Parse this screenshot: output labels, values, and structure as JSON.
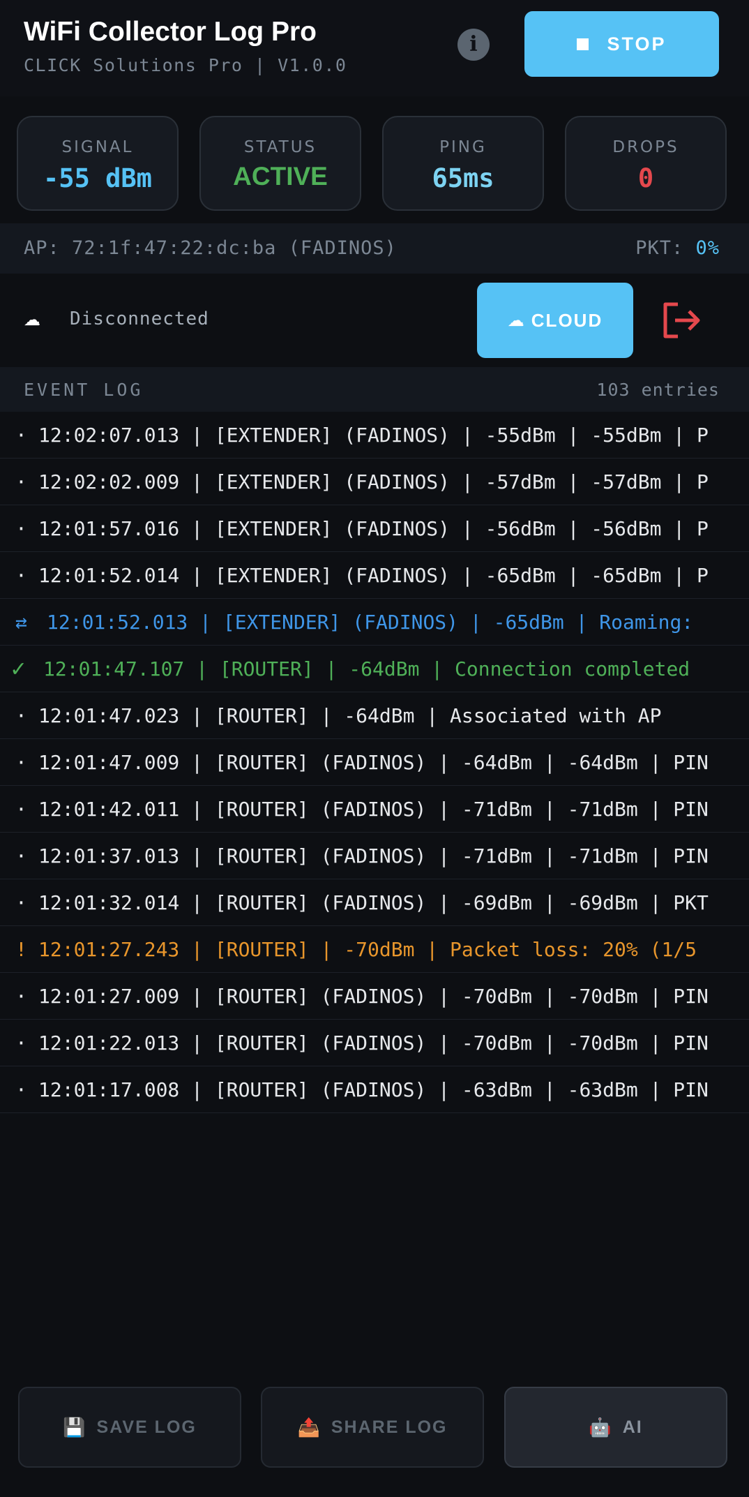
{
  "header": {
    "title": "WiFi Collector Log Pro",
    "subtitle": "CLICK Solutions Pro | V1.0.0",
    "info_icon": "info-icon",
    "stop_label": "STOP"
  },
  "stats": [
    {
      "label": "SIGNAL",
      "value": "-55 dBm",
      "color": "#56c2f5"
    },
    {
      "label": "STATUS",
      "value": "ACTIVE",
      "color": "#4fb058"
    },
    {
      "label": "PING",
      "value": "65ms",
      "color": "#7dd3f2"
    },
    {
      "label": "DROPS",
      "value": "0",
      "color": "#e5484d"
    }
  ],
  "ap": {
    "text": "AP: 72:1f:47:22:dc:ba (FADINOS)",
    "pkt_label": "PKT:",
    "pkt_value": "0%"
  },
  "cloud": {
    "status": "Disconnected",
    "button_label": "CLOUD",
    "icon": "cloud-icon",
    "logout_icon": "logout-icon"
  },
  "event_log": {
    "title": "EVENT LOG",
    "count": "103 entries",
    "entries": [
      {
        "type": "normal",
        "mark": "·",
        "text": "12:02:07.013 | [EXTENDER] (FADINOS) | -55dBm | -55dBm | P"
      },
      {
        "type": "normal",
        "mark": "·",
        "text": "12:02:02.009 | [EXTENDER] (FADINOS) | -57dBm | -57dBm | P"
      },
      {
        "type": "normal",
        "mark": "·",
        "text": "12:01:57.016 | [EXTENDER] (FADINOS) | -56dBm | -56dBm | P"
      },
      {
        "type": "normal",
        "mark": "·",
        "text": "12:01:52.014 | [EXTENDER] (FADINOS) | -65dBm | -65dBm | P"
      },
      {
        "type": "roam",
        "mark": "⇄",
        "text": "12:01:52.013 | [EXTENDER] (FADINOS) | -65dBm | Roaming:"
      },
      {
        "type": "ok",
        "mark": "✓",
        "text": "12:01:47.107 | [ROUTER] | -64dBm | Connection completed"
      },
      {
        "type": "normal",
        "mark": "·",
        "text": "12:01:47.023 | [ROUTER] | -64dBm | Associated with AP"
      },
      {
        "type": "normal",
        "mark": "·",
        "text": "12:01:47.009 | [ROUTER] (FADINOS) | -64dBm | -64dBm | PIN"
      },
      {
        "type": "normal",
        "mark": "·",
        "text": "12:01:42.011 | [ROUTER] (FADINOS) | -71dBm | -71dBm | PIN"
      },
      {
        "type": "normal",
        "mark": "·",
        "text": "12:01:37.013 | [ROUTER] (FADINOS) | -71dBm | -71dBm | PIN"
      },
      {
        "type": "normal",
        "mark": "·",
        "text": "12:01:32.014 | [ROUTER] (FADINOS) | -69dBm | -69dBm | PKT"
      },
      {
        "type": "warn",
        "mark": "!",
        "text": "12:01:27.243 | [ROUTER] | -70dBm | Packet loss: 20% (1/5"
      },
      {
        "type": "normal",
        "mark": "·",
        "text": "12:01:27.009 | [ROUTER] (FADINOS) | -70dBm | -70dBm | PIN"
      },
      {
        "type": "normal",
        "mark": "·",
        "text": "12:01:22.013 | [ROUTER] (FADINOS) | -70dBm | -70dBm | PIN"
      },
      {
        "type": "normal",
        "mark": "·",
        "text": "12:01:17.008 | [ROUTER] (FADINOS) | -63dBm | -63dBm | PIN"
      }
    ]
  },
  "bottom": {
    "save_label": "SAVE LOG",
    "save_icon": "floppy-disk-icon",
    "share_label": "SHARE LOG",
    "share_icon": "outbox-tray-icon",
    "ai_label": "AI",
    "ai_icon": "robot-icon"
  }
}
